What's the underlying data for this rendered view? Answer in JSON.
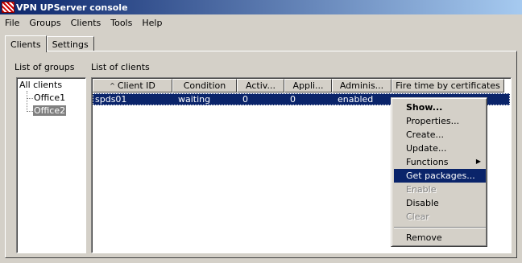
{
  "window": {
    "title": "VPN UPServer console",
    "icon": "vpn-app-icon"
  },
  "menu": [
    {
      "label": "File"
    },
    {
      "label": "Groups"
    },
    {
      "label": "Clients"
    },
    {
      "label": "Tools"
    },
    {
      "label": "Help"
    }
  ],
  "tabs": [
    {
      "label": "Clients",
      "active": true
    },
    {
      "label": "Settings",
      "active": false
    }
  ],
  "groups": {
    "label": "List of groups",
    "root": "All clients",
    "children": [
      "Office1",
      "Office2"
    ],
    "selected": "Office2"
  },
  "clients": {
    "label": "List of clients",
    "columns": [
      "Client ID",
      "Condition",
      "Activ...",
      "Appli...",
      "Adminis...",
      "Fire time by certificates"
    ],
    "rows": [
      {
        "client_id": "spds01",
        "condition": "waiting",
        "active": "0",
        "applied": "0",
        "admin": "enabled",
        "fire_time": ""
      }
    ]
  },
  "context_menu": {
    "items": [
      {
        "label": "Show...",
        "bold": true,
        "disabled": false
      },
      {
        "label": "Properties...",
        "disabled": false
      },
      {
        "label": "Create...",
        "disabled": false
      },
      {
        "label": "Update...",
        "disabled": false
      },
      {
        "label": "Functions",
        "disabled": false,
        "submenu": true
      },
      {
        "label": "Get packages...",
        "disabled": false,
        "highlighted": true
      },
      {
        "label": "Enable",
        "disabled": true
      },
      {
        "label": "Disable",
        "disabled": false
      },
      {
        "label": "Clear",
        "disabled": true
      },
      {
        "label": "Remove",
        "disabled": false
      }
    ]
  },
  "colors": {
    "titlebar_start": "#0a246a",
    "titlebar_end": "#a6caf0",
    "selection": "#0a246a",
    "face": "#d4d0c8"
  }
}
